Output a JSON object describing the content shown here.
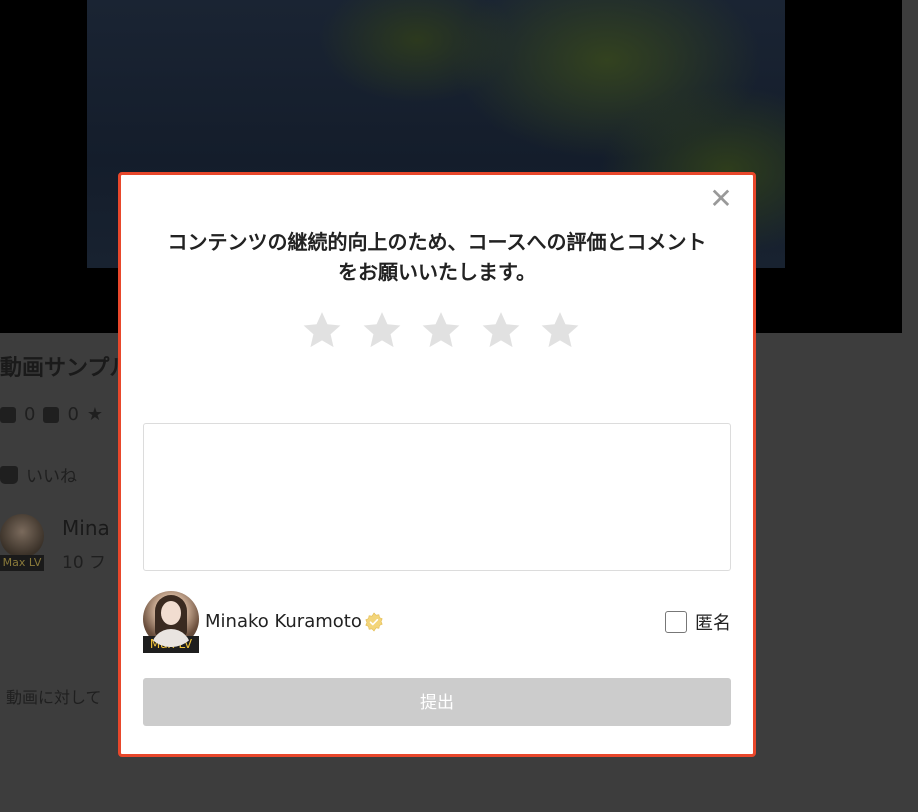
{
  "background": {
    "title": "動画サンプル",
    "stats": {
      "members": "0",
      "videos": "0"
    },
    "like_label": "いいね",
    "author_name": "Mina",
    "author_sub": "10 フ",
    "author_badge": "Max LV",
    "comment_prompt": "動画に対して"
  },
  "modal": {
    "close_symbol": "✕",
    "title_line1": "コンテンツの継続的向上のため、コースへの評価とコメント",
    "title_line2": "をお願いいたします。",
    "rating": {
      "value": 0,
      "max": 5
    },
    "comment": {
      "value": "",
      "placeholder": ""
    },
    "user": {
      "name": "Minako Kuramoto",
      "badge": "Max LV",
      "verified_icon": "verified-badge-icon"
    },
    "anonymous_label": "匿名",
    "anonymous_checked": false,
    "submit_label": "提出"
  },
  "colors": {
    "modal_border": "#e8472b",
    "star_empty": "#e1e1e1",
    "submit_disabled_bg": "#cccccc",
    "badge_text": "#f1c33b"
  }
}
